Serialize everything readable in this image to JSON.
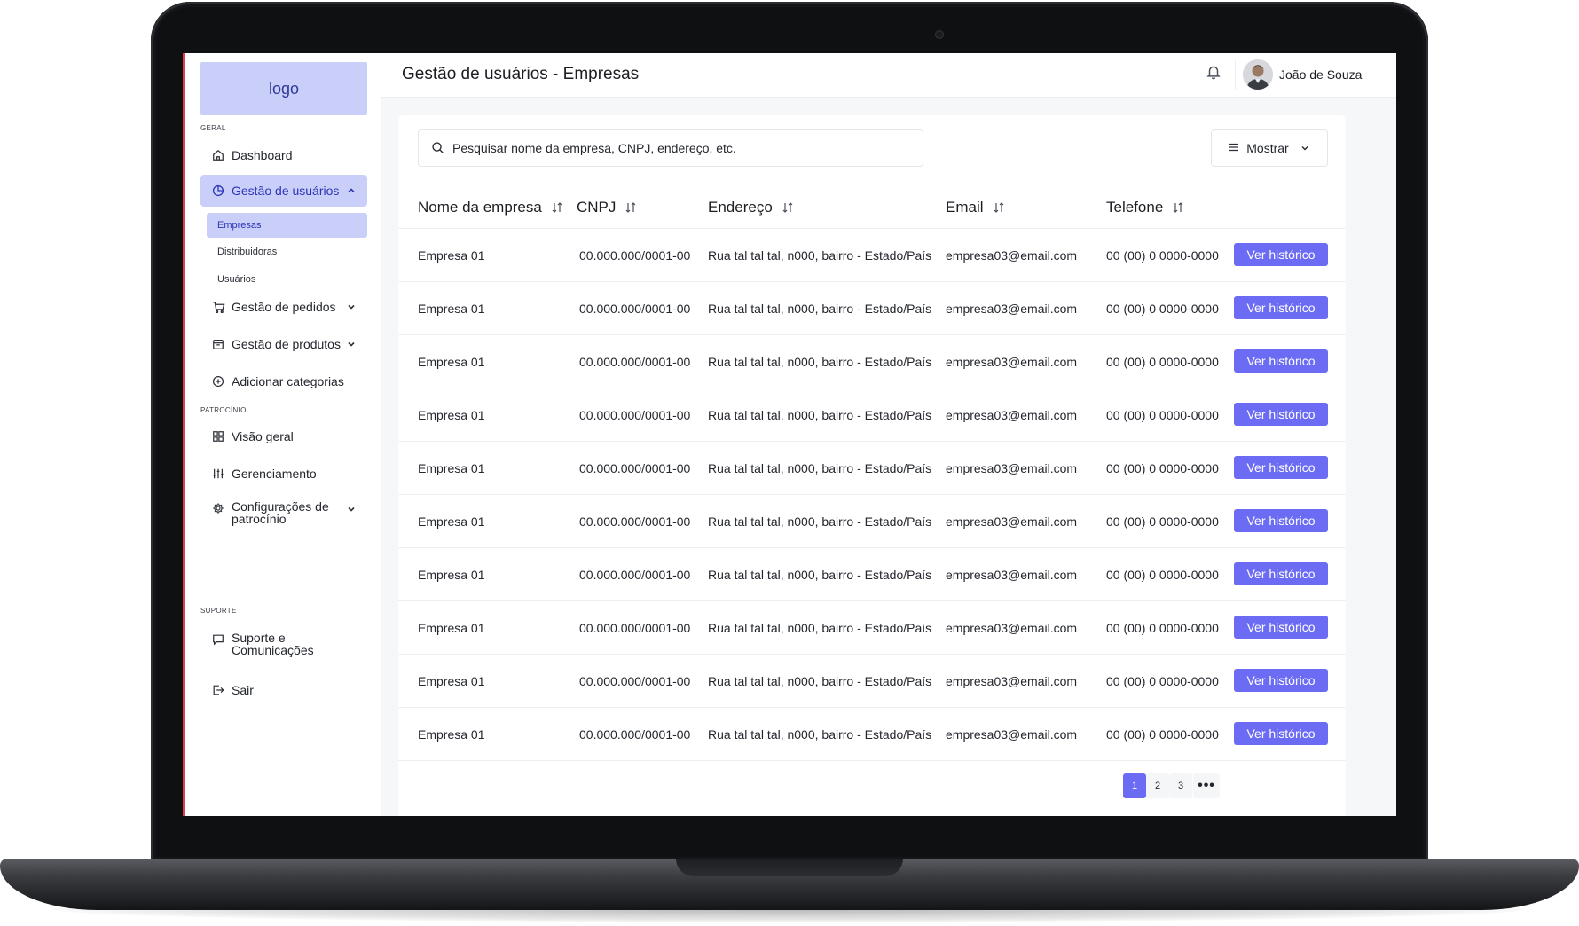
{
  "brand": {
    "logo_text": "logo",
    "accent": "#6b6cf3",
    "active_bg": "#c9cff9"
  },
  "header": {
    "title": "Gestão de usuários - Empresas",
    "user_name": "João de Souza"
  },
  "sidebar": {
    "section_general": "GERAL",
    "section_sponsorship": "PATROCÍNIO",
    "section_support": "SUPORTE",
    "items": {
      "dashboard": "Dashboard",
      "user_mgmt": "Gestão de usuários",
      "sub_companies": "Empresas",
      "sub_distributors": "Distribuidoras",
      "sub_users": "Usuários",
      "orders": "Gestão de pedidos",
      "products": "Gestão de produtos",
      "categories": "Adicionar categorias",
      "overview": "Visão geral",
      "management": "Gerenciamento",
      "sponsor_settings_1": "Configurações de",
      "sponsor_settings_2": "patrocínio",
      "support_1": "Suporte e",
      "support_2": "Comunicações",
      "logout": "Sair"
    }
  },
  "toolbar": {
    "search_placeholder": "Pesquisar nome da empresa, CNPJ, endereço, etc.",
    "show_label": "Mostrar"
  },
  "table": {
    "columns": [
      "Nome da empresa",
      "CNPJ",
      "Endereço",
      "Email",
      "Telefone"
    ],
    "action_label": "Ver histórico",
    "rows": [
      [
        "Empresa 01",
        "00.000.000/0001-00",
        "Rua tal tal tal, n000, bairro - Estado/País",
        "empresa03@email.com",
        "00 (00) 0 0000-0000"
      ],
      [
        "Empresa 01",
        "00.000.000/0001-00",
        "Rua tal tal tal, n000, bairro - Estado/País",
        "empresa03@email.com",
        "00 (00) 0 0000-0000"
      ],
      [
        "Empresa 01",
        "00.000.000/0001-00",
        "Rua tal tal tal, n000, bairro - Estado/País",
        "empresa03@email.com",
        "00 (00) 0 0000-0000"
      ],
      [
        "Empresa 01",
        "00.000.000/0001-00",
        "Rua tal tal tal, n000, bairro - Estado/País",
        "empresa03@email.com",
        "00 (00) 0 0000-0000"
      ],
      [
        "Empresa 01",
        "00.000.000/0001-00",
        "Rua tal tal tal, n000, bairro - Estado/País",
        "empresa03@email.com",
        "00 (00) 0 0000-0000"
      ],
      [
        "Empresa 01",
        "00.000.000/0001-00",
        "Rua tal tal tal, n000, bairro - Estado/País",
        "empresa03@email.com",
        "00 (00) 0 0000-0000"
      ],
      [
        "Empresa 01",
        "00.000.000/0001-00",
        "Rua tal tal tal, n000, bairro - Estado/País",
        "empresa03@email.com",
        "00 (00) 0 0000-0000"
      ],
      [
        "Empresa 01",
        "00.000.000/0001-00",
        "Rua tal tal tal, n000, bairro - Estado/País",
        "empresa03@email.com",
        "00 (00) 0 0000-0000"
      ],
      [
        "Empresa 01",
        "00.000.000/0001-00",
        "Rua tal tal tal, n000, bairro - Estado/País",
        "empresa03@email.com",
        "00 (00) 0 0000-0000"
      ],
      [
        "Empresa 01",
        "00.000.000/0001-00",
        "Rua tal tal tal, n000, bairro - Estado/País",
        "empresa03@email.com",
        "00 (00) 0 0000-0000"
      ]
    ]
  },
  "pagination": {
    "pages": [
      "1",
      "2",
      "3"
    ],
    "current": "1",
    "more": "•••"
  }
}
